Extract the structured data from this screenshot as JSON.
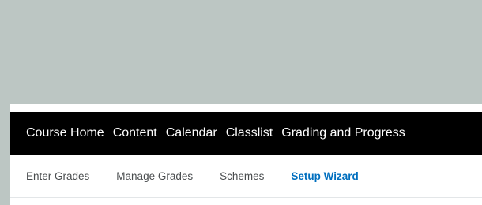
{
  "colors": {
    "background": "#bcc6c3",
    "navbar": "#000000",
    "active_tab": "#006fbf",
    "tab_text": "#494c4e"
  },
  "navbar": {
    "items": [
      {
        "label": "Course Home"
      },
      {
        "label": "Content"
      },
      {
        "label": "Calendar"
      },
      {
        "label": "Classlist"
      },
      {
        "label": "Grading and Progress"
      }
    ]
  },
  "subnav": {
    "items": [
      {
        "label": "Enter Grades",
        "active": false
      },
      {
        "label": "Manage Grades",
        "active": false
      },
      {
        "label": "Schemes",
        "active": false
      },
      {
        "label": "Setup Wizard",
        "active": true
      }
    ]
  }
}
